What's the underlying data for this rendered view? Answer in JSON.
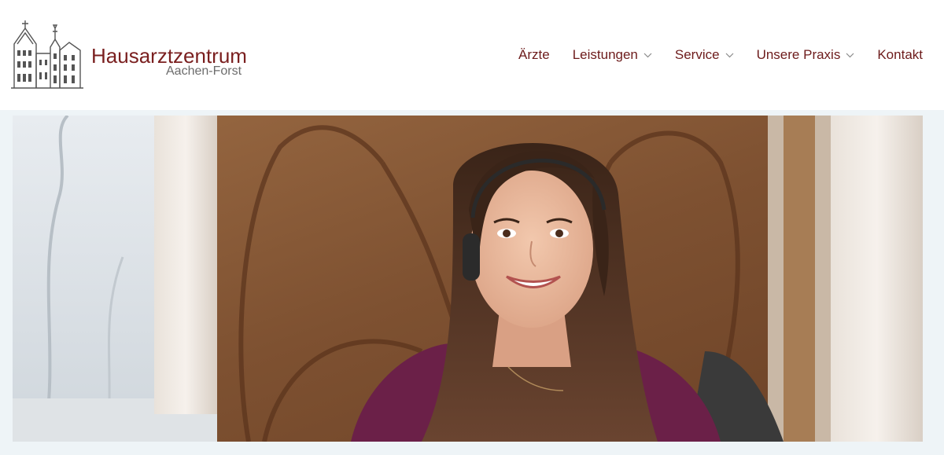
{
  "brand": {
    "name": "Hausarztzentrum",
    "subtitle": "Aachen-Forst",
    "logo_icon": "villa-building-icon",
    "colors": {
      "primary": "#7a1f1f",
      "subtitle": "#6c6c6c"
    }
  },
  "nav": {
    "items": [
      {
        "label": "Ärzte",
        "has_dropdown": false
      },
      {
        "label": "Leistungen",
        "has_dropdown": true
      },
      {
        "label": "Service",
        "has_dropdown": true
      },
      {
        "label": "Unsere Praxis",
        "has_dropdown": true
      },
      {
        "label": "Kontakt",
        "has_dropdown": false
      }
    ],
    "dropdown_icon": "chevron-down-icon",
    "color": "#6d1b1b"
  },
  "hero": {
    "image_subject": "receptionist-with-headset",
    "background_color": "#eef4f7"
  }
}
